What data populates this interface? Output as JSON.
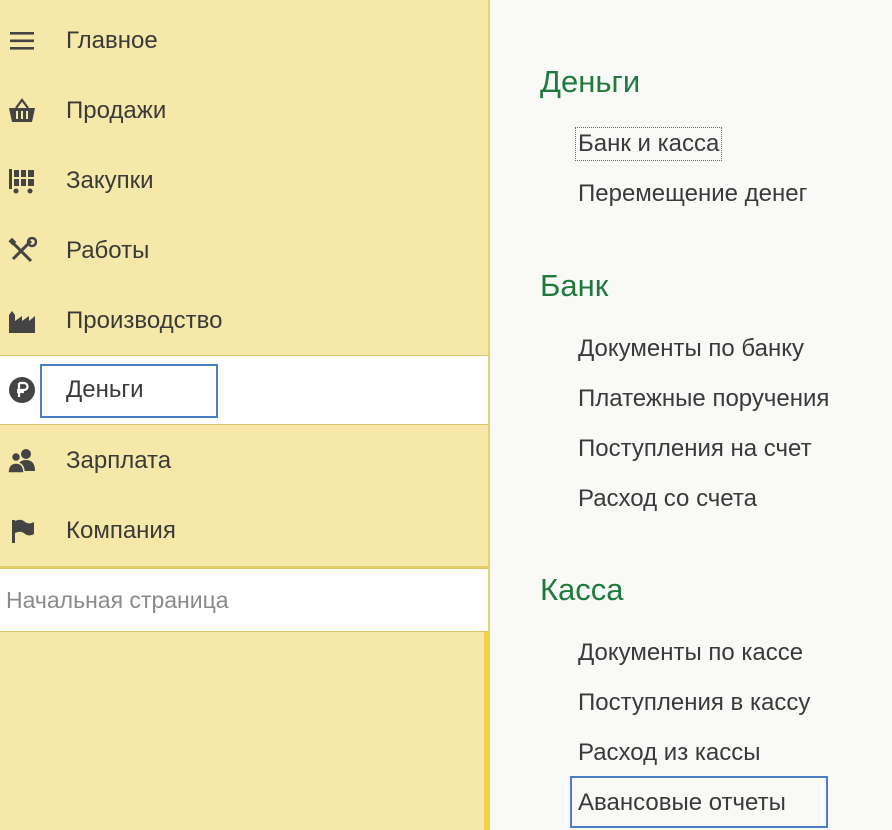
{
  "sidebar": {
    "items": [
      {
        "label": "Главное",
        "icon": "menu-icon"
      },
      {
        "label": "Продажи",
        "icon": "basket-icon"
      },
      {
        "label": "Закупки",
        "icon": "cart-icon"
      },
      {
        "label": "Работы",
        "icon": "tools-icon"
      },
      {
        "label": "Производство",
        "icon": "factory-icon"
      },
      {
        "label": "Деньги",
        "icon": "ruble-icon",
        "active": true
      },
      {
        "label": "Зарплата",
        "icon": "people-icon"
      },
      {
        "label": "Компания",
        "icon": "flag-icon"
      }
    ],
    "start_page": "Начальная страница"
  },
  "content": {
    "sections": [
      {
        "title": "Деньги",
        "links": [
          "Банк и касса",
          "Перемещение денег"
        ]
      },
      {
        "title": "Банк",
        "links": [
          "Документы по банку",
          "Платежные поручения",
          "Поступления на счет",
          "Расход со счета"
        ]
      },
      {
        "title": "Касса",
        "links": [
          "Документы по кассе",
          "Поступления в кассу",
          "Расход из кассы",
          "Авансовые отчеты"
        ]
      }
    ]
  },
  "colors": {
    "sidebar_bg": "#f5e8a8",
    "section_title": "#1f7a3c",
    "focus_border": "#4a7fc8"
  }
}
